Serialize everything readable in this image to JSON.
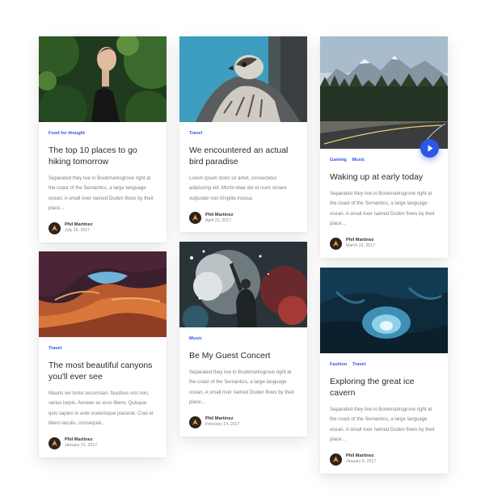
{
  "cards": [
    {
      "tags": [
        "Food for thought"
      ],
      "title": "The top 10 places to go hiking tomorrow",
      "excerpt": "Separated they live in Bookmarksgrove right at the coast of the Semantics, a large language ocean. A small river named Duden flows by their place...",
      "author": "Phil Martinez",
      "date": "July 15, 2017"
    },
    {
      "tags": [
        "Travel"
      ],
      "title": "We encountered an actual bird paradise",
      "excerpt": "Lorem ipsum dolor sit amet, consectetur adipiscing elit. Morbi vitae dui et nunc ornare vulputate non fringilla massa.",
      "author": "Phil Martinez",
      "date": "April 21, 2017"
    },
    {
      "tags": [
        "Gaming",
        "Music"
      ],
      "title": "Waking up at early today",
      "excerpt": "Separated they live in Bookmarksgrove right at the coast of the Semantics, a large language ocean. A small river named Duden flows by their place...",
      "author": "Phil Martinez",
      "date": "March 22, 2017"
    },
    {
      "tags": [
        "Travel"
      ],
      "title": "The most beautiful canyons you'll ever see",
      "excerpt": "Mauris vel tortor accumsan, faucibus orci non, varius turpis. Aenean ac eros libero. Quisque quis sapien in ante scelerisque placerat. Cras et libero iaculis, consequat...",
      "author": "Phil Martinez",
      "date": "January 21, 2017"
    },
    {
      "tags": [
        "Music"
      ],
      "title": "Be My Guest Concert",
      "excerpt": "Separated they live in Bookmarksgrove right at the coast of the Semantics, a large language ocean. A small river named Duden flows by their place...",
      "author": "Phil Martinez",
      "date": "February 14, 2017"
    },
    {
      "tags": [
        "Fashion",
        "Travel"
      ],
      "title": "Exploring the great ice cavern",
      "excerpt": "Separated they live in Bookmarksgrove right at the coast of the Semantics, a large language ocean. A small river named Duden flows by their place...",
      "author": "Phil Martinez",
      "date": "January 5, 2017"
    }
  ],
  "colors": {
    "accent": "#2e57e8",
    "title": "#2b2b2b",
    "excerpt": "#808080"
  },
  "icons": {
    "play": "play-icon",
    "avatar": "avatar-logo-icon"
  }
}
